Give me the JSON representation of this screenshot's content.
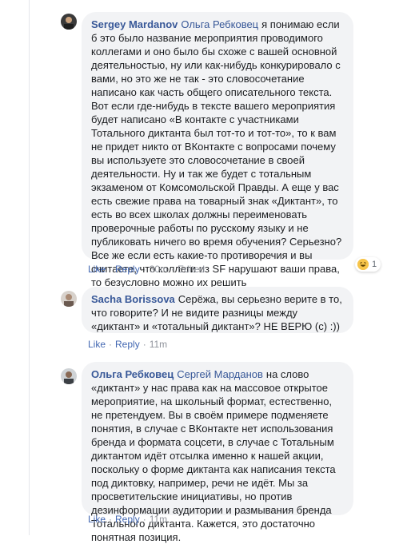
{
  "comments": [
    {
      "author": "Sergey Mardanov",
      "mention": "Ольга Ребковец",
      "text": "я понимаю если б это было название мероприятия проводимого коллегами и оно было бы схоже с вашей основной деятельностью, ну или как-нибудь конкурировало с вами, но это же не так - это словосочетание написано как часть общего описательного текста. Вот если где-нибудь в тексте вашего мероприятия будет написано «В контакте с участниками Тотального диктанта был тот-то и тот-то», то к вам не придет никто от ВКонтакте с вопросами почему вы используете это словосочетание в своей деятельности. Ну и так же будет с тотальным экзаменом от Комсомольской Правды. А еще у вас есть свежие права на товарный знак «Диктант», то есть во всех школах должны переименовать проверочные работы по русскому языку и не публиковать ничего во время обучения? Серьезно?",
      "text2": "Все же если есть какие-то противоречия и вы считаете, что коллеги из SF нарушают ваши права, то безусловно можно их решить",
      "actions": {
        "like": "Like",
        "reply": "Reply",
        "time": "30m",
        "edited": "Edited"
      },
      "reaction": {
        "icon": "haha-reaction-icon",
        "count": "1"
      }
    },
    {
      "author": "Sacha Borissova",
      "text": "Серёжа, вы серьезно верите в то, что говорите? И не видите разницы между «диктант» и «тотальный диктант»? НЕ ВЕРЮ (с) :))",
      "actions": {
        "like": "Like",
        "reply": "Reply",
        "time": "11m"
      }
    },
    {
      "author": "Ольга Ребковец",
      "mention": "Сергей Марданов",
      "text": "на слово «диктант» у нас права как на массовое открытое мероприятие, на школьный формат, естественно, не претендуем. Вы в своём примере подменяете понятия, в случае с ВКонтакте нет использования бренда и формата соцсети, в случае с Тотальным диктантом идёт отсылка именно к нашей акции, поскольку о форме диктанта как написания текста под диктовку, например, речи не идёт. Мы за просветительские инициативы, но против дезинформации аудитории и размывания бренда Тотального диктанта. Кажется, это достаточно понятная позиция.",
      "actions": {
        "like": "Like",
        "reply": "Reply",
        "time": "11m"
      }
    }
  ],
  "colors": {
    "link": "#385898",
    "action": "#4267b2",
    "bubble": "#f2f3f5",
    "meta": "#90949c"
  }
}
